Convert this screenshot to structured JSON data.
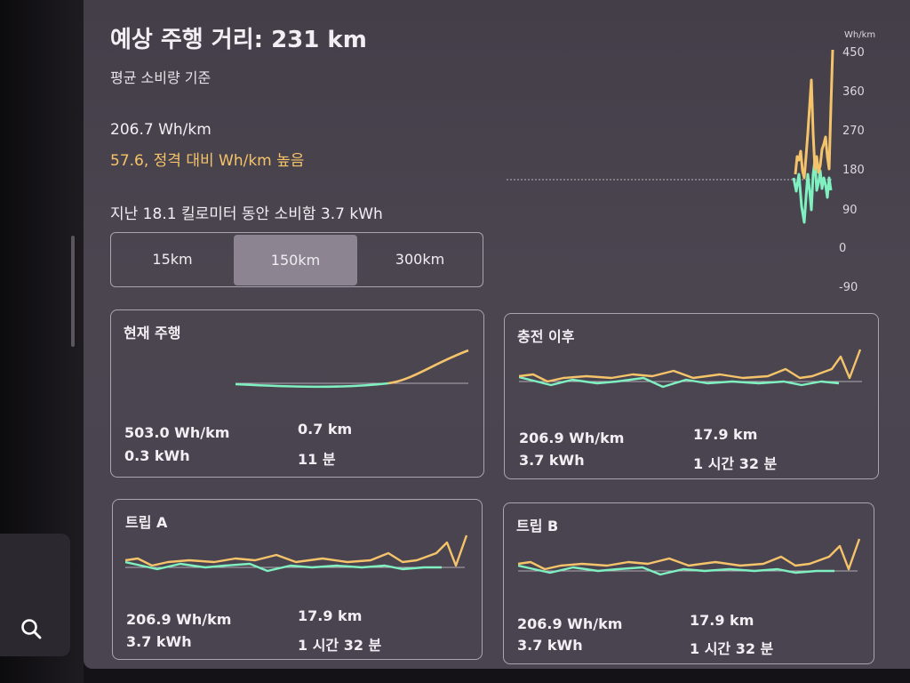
{
  "header": {
    "title": "예상 주행 거리: 231 km",
    "subtitle": "평균 소비량 기준",
    "average": "206.7 Wh/km",
    "delta": "57.6, 정격 대비 Wh/km 높음",
    "consumed": "지난 18.1 킬로미터 동안 소비함 3.7 kWh"
  },
  "range_selector": {
    "options": [
      "15km",
      "150km",
      "300km"
    ],
    "selected": "150km"
  },
  "main_chart": {
    "unit": "Wh/km",
    "ticks": [
      "450",
      "360",
      "270",
      "180",
      "90",
      "0",
      "-90"
    ]
  },
  "cards": {
    "current": {
      "title": "현재 주행",
      "consumption": "503.0 Wh/km",
      "energy": "0.3 kWh",
      "distance": "0.7 km",
      "time": "11 분"
    },
    "since_charge": {
      "title": "충전 이후",
      "consumption": "206.9 Wh/km",
      "energy": "3.7 kWh",
      "distance": "17.9 km",
      "time": "1 시간 32 분"
    },
    "trip_a": {
      "title": "트립 A",
      "consumption": "206.9 Wh/km",
      "energy": "3.7 kWh",
      "distance": "17.9 km",
      "time": "1 시간 32 분"
    },
    "trip_b": {
      "title": "트립 B",
      "consumption": "206.9 Wh/km",
      "energy": "3.7 kWh",
      "distance": "17.9 km",
      "time": "1 시간 32 분"
    }
  },
  "icons": {
    "search": "search-icon"
  },
  "colors": {
    "above_rated": "#f5c46a",
    "below_rated": "#7ff0c0",
    "panel": "#4a4450",
    "border": "#aaa4ae"
  }
}
